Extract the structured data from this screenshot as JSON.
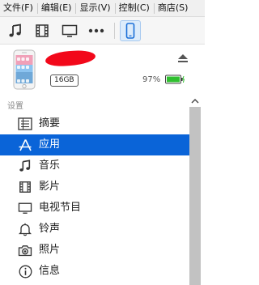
{
  "menu": {
    "items": [
      "文件(F)",
      "编辑(E)",
      "显示(V)",
      "控制(C)",
      "商店(S)"
    ]
  },
  "toolbar": {
    "buttons": [
      "music-icon",
      "film-icon",
      "tv-icon",
      "more-icon",
      "iphone-icon"
    ]
  },
  "device": {
    "capacity": "16GB",
    "battery_percent": "97%",
    "battery_color": "#2fbf2f"
  },
  "sidebar": {
    "section_label": "设置",
    "items": [
      {
        "label": "摘要",
        "icon": "summary-icon"
      },
      {
        "label": "应用",
        "icon": "apps-icon",
        "selected": true
      },
      {
        "label": "音乐",
        "icon": "music-icon"
      },
      {
        "label": "影片",
        "icon": "film-icon"
      },
      {
        "label": "电视节目",
        "icon": "tv-icon"
      },
      {
        "label": "铃声",
        "icon": "bell-icon"
      },
      {
        "label": "照片",
        "icon": "camera-icon"
      },
      {
        "label": "信息",
        "icon": "info-icon"
      }
    ]
  },
  "colors": {
    "selection": "#0a64d8",
    "scrollbar": "#c2c2c2"
  }
}
